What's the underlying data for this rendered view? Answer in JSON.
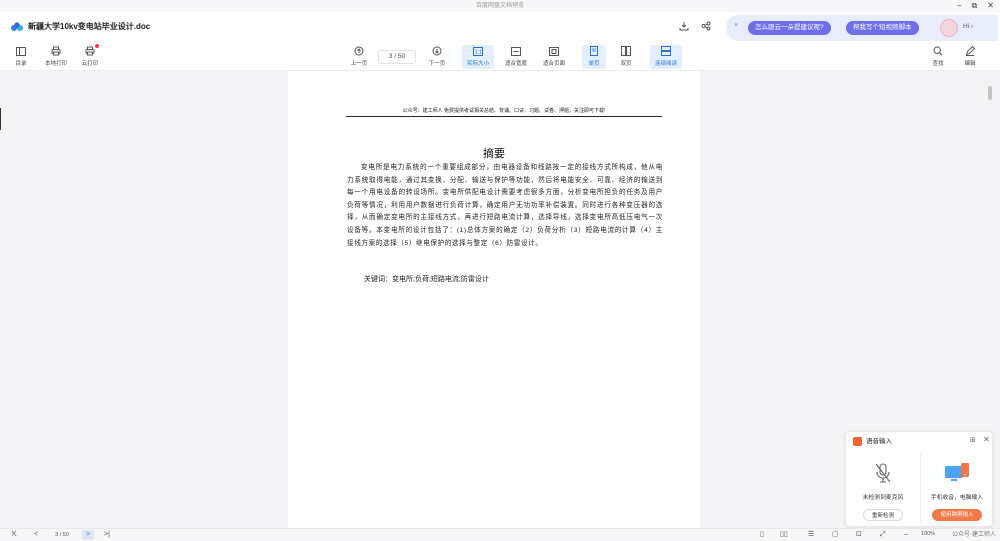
{
  "window": {
    "title": "百度网盘文档预览",
    "controls": {
      "minimize": "–",
      "restore": "⧉",
      "close": "✕"
    }
  },
  "header": {
    "doc_title": "新疆大学10kv变电站毕业设计.doc",
    "download_icon": "download-icon",
    "share_icon": "share-icon"
  },
  "assistant": {
    "close": "×",
    "pill1": "怎么跟云一朵提建议呢?",
    "pill2": "帮我写个短视频脚本",
    "greeting": "Hi ›"
  },
  "toolbar": {
    "toc": "目录",
    "local_print": "本地打印",
    "cloud_print": "云打印",
    "prev": "上一页",
    "page_indicator": "3 / 50",
    "next": "下一页",
    "actual_size": "实际大小",
    "fit_width": "适合宽度",
    "fit_page": "适合页面",
    "single_page": "单页",
    "double_page": "双页",
    "continuous": "连续阅读",
    "find": "查找",
    "edit": "编辑"
  },
  "document": {
    "header_note": "公众号：建工师人 免费提供考试相关总结、背诵、口诀、习题、试卷、押题，关注即可下载!",
    "title": "摘要",
    "abstract": "变电所是电力系统的一个重要组成部分，由电器设备和线路按一定的接线方式所构成，他从电力系统取得电能，通过其变换、分配、输送与保护等功能，然后将电能安全、可靠、经济的输送到每一个用电设备的转设场所。变电所供配电设计需要考虑很多方面，分析变电所担负的任务及用户负荷等情况，利用用户数据进行负荷计算，确定用户无功功率补偿装置。同时进行各种变压器的选择，从而确定变电所的主接线方式，再进行短路电流计算，选择导线，选择变电所高低压电气一次设备等。本变电所的设计包括了：(1)总体方案的确定（2）负荷分析（3）短路电流的计算（4）主接线方案的选择（5）继电保护的选择与整定（6）防雷设计。",
    "keywords": "关键词：变电所;负荷;短路电流;防雷设计"
  },
  "voice_popup": {
    "title": "语音输入",
    "left_text": "未检测到麦克风",
    "left_button": "重新检测",
    "right_text": "手机收音，电脑输入",
    "right_button": "使用跨屏输入",
    "close": "✕"
  },
  "bottom_bar": {
    "first": "K",
    "prev": "<",
    "page": "3 / 50",
    "next": ">",
    "last": ">|",
    "zoom": "100%",
    "watermark": "公众号·建工师人"
  },
  "colors": {
    "accent": "#2a6fe0",
    "assist_pill": "#6e6eea",
    "voice_button": "#f07a4a",
    "notification_dot": "#ff3333"
  }
}
